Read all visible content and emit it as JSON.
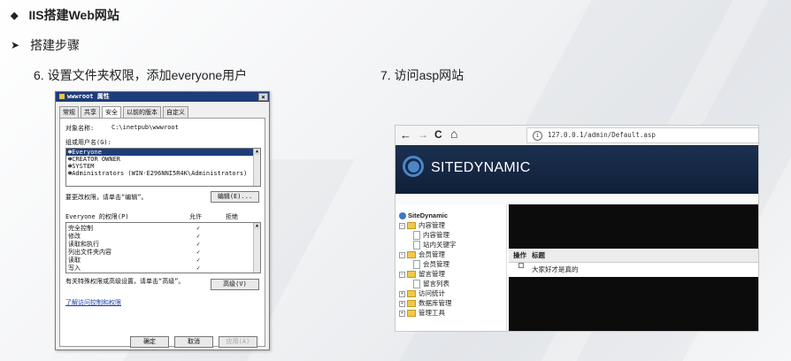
{
  "slide": {
    "heading": "IIS搭建Web网站",
    "subheading": "搭建步骤",
    "step6_caption": "6.  设置文件夹权限，添加everyone用户",
    "step7_caption": "7.  访问asp网站"
  },
  "dialog": {
    "title": "wwwroot 属性",
    "close": "×",
    "tabs": [
      "常规",
      "共享",
      "安全",
      "以前的版本",
      "自定义"
    ],
    "object_label": "对象名称:",
    "object_value": "C:\\inetpub\\wwwroot",
    "groups_label": "组或用户名(G):",
    "users": [
      "Everyone",
      "CREATOR OWNER",
      "SYSTEM",
      "Administrators (WIN-E296NNI5R4K\\Administrators)"
    ],
    "change_hint": "要更改权限，请单击“编辑”。",
    "edit_button": "编辑(E)...",
    "perm_header": "Everyone 的权限(P)",
    "allow_label": "允许",
    "deny_label": "拒绝",
    "permissions": [
      {
        "name": "完全控制",
        "allow": "✓"
      },
      {
        "name": "修改",
        "allow": "✓"
      },
      {
        "name": "读取和执行",
        "allow": "✓"
      },
      {
        "name": "列出文件夹内容",
        "allow": "✓"
      },
      {
        "name": "读取",
        "allow": "✓"
      },
      {
        "name": "写入",
        "allow": "✓"
      }
    ],
    "advanced_hint": "有关特殊权限或高级设置，请单击“高级”。",
    "advanced_button": "高级(V)",
    "learn_link": "了解访问控制和权限",
    "ok_button": "确定",
    "cancel_button": "取消",
    "apply_button": "应用(A)"
  },
  "browser": {
    "back": "←",
    "forward": "→",
    "reload": "C",
    "home": "⌂",
    "url": "127.0.0.1/admin/Default.asp",
    "site_name": "SITEDYNAMIC",
    "tree": {
      "root": "SiteDynamic",
      "items": [
        {
          "label": "内容管理",
          "kind": "folder"
        },
        {
          "label": "内容管理",
          "kind": "page"
        },
        {
          "label": "站内关键字",
          "kind": "page"
        },
        {
          "label": "会员管理",
          "kind": "folder"
        },
        {
          "label": "会员管理",
          "kind": "page"
        },
        {
          "label": "留言管理",
          "kind": "folder"
        },
        {
          "label": "留言列表",
          "kind": "page"
        },
        {
          "label": "访问统计",
          "kind": "folder"
        },
        {
          "label": "数据库管理",
          "kind": "folder"
        },
        {
          "label": "管理工具",
          "kind": "folder"
        }
      ]
    },
    "table_headers": [
      "操作",
      "标题"
    ],
    "rows": [
      {
        "title": "大家好才是真的"
      }
    ]
  }
}
